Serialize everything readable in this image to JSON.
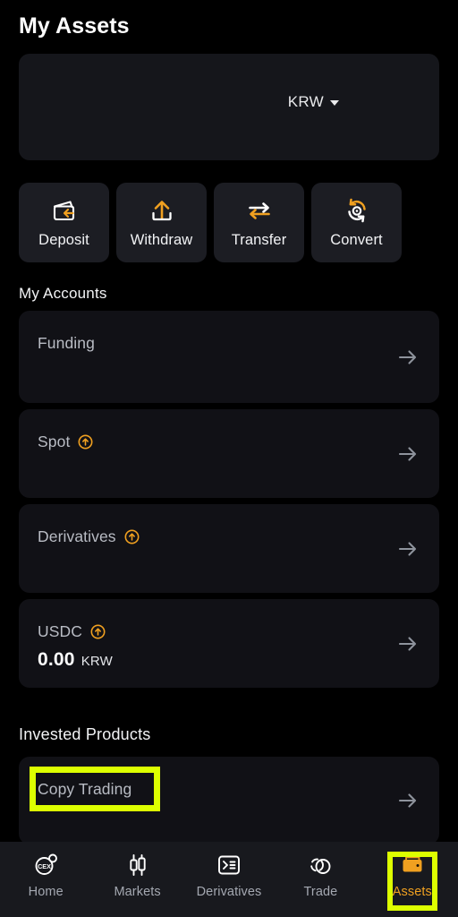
{
  "header": {
    "title": "My Assets"
  },
  "balance_card": {
    "currency": "KRW",
    "caret_icon": "chevron-down-icon"
  },
  "actions": [
    {
      "label": "Deposit",
      "icon": "deposit-wallet-icon"
    },
    {
      "label": "Withdraw",
      "icon": "withdraw-upload-icon"
    },
    {
      "label": "Transfer",
      "icon": "transfer-arrows-icon"
    },
    {
      "label": "Convert",
      "icon": "convert-refresh-icon"
    }
  ],
  "accounts_section": {
    "title": "My Accounts",
    "items": [
      {
        "label": "Funding",
        "has_badge": false,
        "amount": "",
        "unit": ""
      },
      {
        "label": "Spot",
        "has_badge": true,
        "amount": "",
        "unit": ""
      },
      {
        "label": "Derivatives",
        "has_badge": true,
        "amount": "",
        "unit": ""
      },
      {
        "label": "USDC",
        "has_badge": true,
        "amount": "0.00",
        "unit": "KRW"
      }
    ]
  },
  "invested_section": {
    "title": "Invested Products",
    "items": [
      {
        "label": "Copy Trading",
        "has_badge": false,
        "amount": "",
        "unit": ""
      }
    ]
  },
  "bottom_nav": {
    "items": [
      {
        "label": "Home",
        "icon": "cex-circle-icon",
        "active": false
      },
      {
        "label": "Markets",
        "icon": "candlestick-icon",
        "active": false
      },
      {
        "label": "Derivatives",
        "icon": "terminal-box-icon",
        "active": false
      },
      {
        "label": "Trade",
        "icon": "two-circles-icon",
        "active": false
      },
      {
        "label": "Assets",
        "icon": "wallet-icon",
        "active": true
      }
    ]
  },
  "annotations": {
    "highlight_color": "#ddff00",
    "targets": [
      "Copy Trading",
      "Assets"
    ]
  },
  "colors": {
    "background": "#000000",
    "card": "#111116",
    "accent_orange": "#f0a020",
    "highlight": "#ddff00"
  }
}
